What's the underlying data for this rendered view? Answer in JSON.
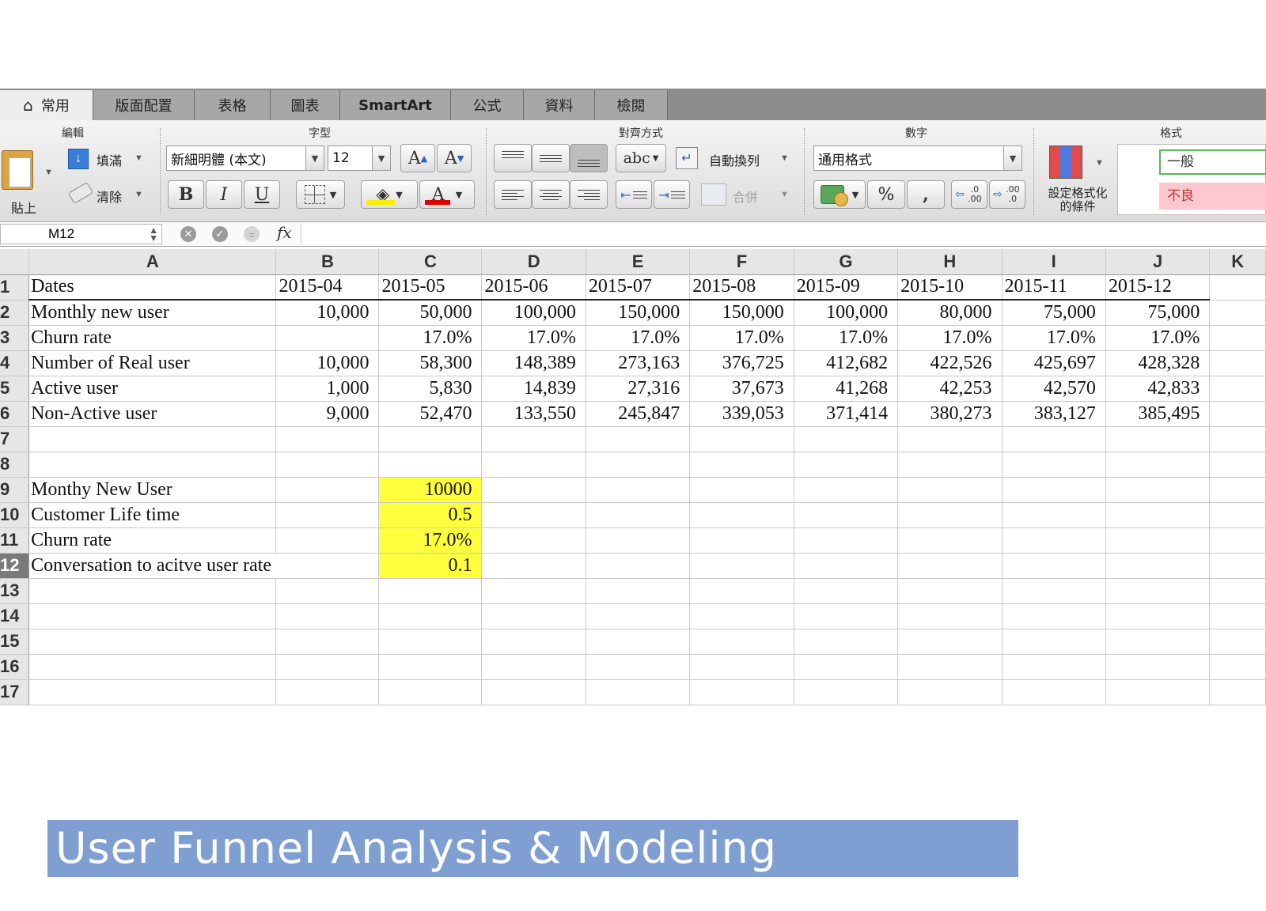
{
  "ribbon_tabs": [
    "常用",
    "版面配置",
    "表格",
    "圖表",
    "SmartArt",
    "公式",
    "資料",
    "檢閱"
  ],
  "groups": {
    "edit": {
      "title": "編輯",
      "paste": "貼上",
      "fill": "填滿",
      "clear": "清除"
    },
    "font": {
      "title": "字型",
      "font_name": "新細明體 (本文)",
      "font_size": "12",
      "grow": "A",
      "shrink": "A",
      "bold": "B",
      "italic": "I",
      "underline": "U",
      "font_color": "A",
      "fill_color": "#ffee00",
      "text_color": "#e00000"
    },
    "align": {
      "title": "對齊方式",
      "abc": "abc",
      "wrap": "自動換列",
      "merge": "合併"
    },
    "number": {
      "title": "數字",
      "format": "通用格式",
      "percent": "%",
      "comma": ",",
      "inc_decimal": ".0 .00",
      "dec_decimal": ".00 .0"
    },
    "style": {
      "title": "格式",
      "conditional": "設定格式化\n的條件",
      "normal": "一般",
      "bad": "不良"
    }
  },
  "name_box": "M12",
  "formula_icon": "fx",
  "columns": [
    "A",
    "B",
    "C",
    "D",
    "E",
    "F",
    "G",
    "H",
    "I",
    "J",
    "K"
  ],
  "rows": [
    [
      "Dates",
      "2015-04",
      "2015-05",
      "2015-06",
      "2015-07",
      "2015-08",
      "2015-09",
      "2015-10",
      "2015-11",
      "2015-12",
      ""
    ],
    [
      "Monthly new user",
      "10,000",
      "50,000",
      "100,000",
      "150,000",
      "150,000",
      "100,000",
      "80,000",
      "75,000",
      "75,000",
      ""
    ],
    [
      "Churn rate",
      "",
      "17.0%",
      "17.0%",
      "17.0%",
      "17.0%",
      "17.0%",
      "17.0%",
      "17.0%",
      "17.0%",
      ""
    ],
    [
      "Number of Real user",
      "10,000",
      "58,300",
      "148,389",
      "273,163",
      "376,725",
      "412,682",
      "422,526",
      "425,697",
      "428,328",
      ""
    ],
    [
      "Active user",
      "1,000",
      "5,830",
      "14,839",
      "27,316",
      "37,673",
      "41,268",
      "42,253",
      "42,570",
      "42,833",
      ""
    ],
    [
      "Non-Active user",
      "9,000",
      "52,470",
      "133,550",
      "245,847",
      "339,053",
      "371,414",
      "380,273",
      "383,127",
      "385,495",
      ""
    ],
    [
      "",
      "",
      "",
      "",
      "",
      "",
      "",
      "",
      "",
      "",
      ""
    ],
    [
      "",
      "",
      "",
      "",
      "",
      "",
      "",
      "",
      "",
      "",
      ""
    ],
    [
      "Monthy New User",
      "",
      "10000",
      "",
      "",
      "",
      "",
      "",
      "",
      "",
      ""
    ],
    [
      "Customer Life time",
      "",
      "0.5",
      "",
      "",
      "",
      "",
      "",
      "",
      "",
      ""
    ],
    [
      "Churn rate",
      "",
      "17.0%",
      "",
      "",
      "",
      "",
      "",
      "",
      "",
      ""
    ],
    [
      "Conversation to acitve user rate",
      "",
      "0.1",
      "",
      "",
      "",
      "",
      "",
      "",
      "",
      ""
    ],
    [
      "",
      "",
      "",
      "",
      "",
      "",
      "",
      "",
      "",
      "",
      ""
    ],
    [
      "",
      "",
      "",
      "",
      "",
      "",
      "",
      "",
      "",
      "",
      ""
    ],
    [
      "",
      "",
      "",
      "",
      "",
      "",
      "",
      "",
      "",
      "",
      ""
    ],
    [
      "",
      "",
      "",
      "",
      "",
      "",
      "",
      "",
      "",
      "",
      ""
    ],
    [
      "",
      "",
      "",
      "",
      "",
      "",
      "",
      "",
      "",
      "",
      ""
    ]
  ],
  "highlight_color": "#ffff3c",
  "selected_row": 12,
  "title_banner": "User Funnel Analysis & Modeling"
}
